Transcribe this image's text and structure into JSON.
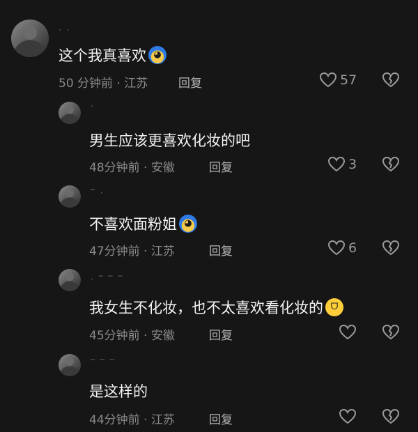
{
  "comments": [
    {
      "text": "这个我真喜欢",
      "emoji": "blue-face-emoji",
      "meta": "50 分钟前 · 江苏",
      "reply_label": "回复",
      "likes": "57"
    },
    {
      "text": "男生应该更喜欢化妆的吧",
      "meta": "48分钟前 · 安徽",
      "reply_label": "回复",
      "likes": "3"
    },
    {
      "text": "不喜欢面粉姐",
      "emoji": "blue-face-emoji",
      "meta": "47分钟前 · 江苏",
      "reply_label": "回复",
      "likes": "6"
    },
    {
      "text": "我女生不化妆，也不太喜欢看化妆的",
      "emoji": "laughing-tears-emoji",
      "meta": "45分钟前 · 安徽",
      "reply_label": "回复",
      "likes": ""
    },
    {
      "text": "是这样的",
      "meta": "44分钟前 · 江苏",
      "reply_label": "回复",
      "likes": ""
    }
  ],
  "icons": {
    "like": "heart-outline-icon",
    "dislike": "broken-heart-icon"
  },
  "colors": {
    "background": "#161616",
    "text": "#f2f2f2",
    "meta": "#8a8a8a"
  }
}
